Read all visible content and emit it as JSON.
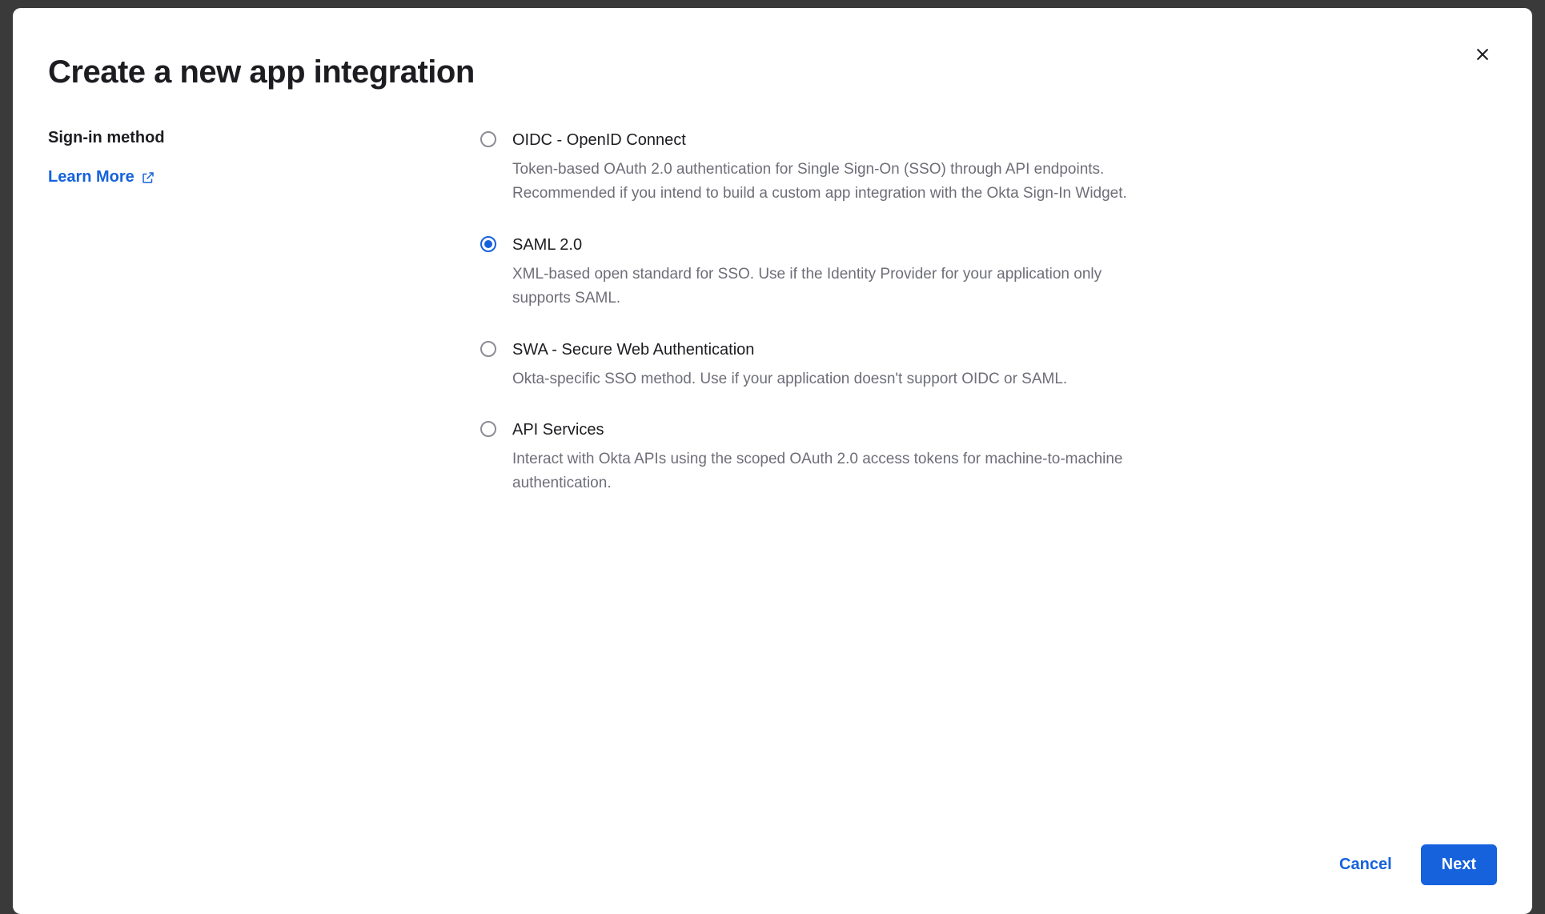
{
  "modal": {
    "title": "Create a new app integration",
    "close_aria": "Close"
  },
  "section": {
    "label": "Sign-in method",
    "learn_more": "Learn More"
  },
  "options": [
    {
      "id": "oidc",
      "title": "OIDC - OpenID Connect",
      "description": "Token-based OAuth 2.0 authentication for Single Sign-On (SSO) through API endpoints. Recommended if you intend to build a custom app integration with the Okta Sign-In Widget.",
      "selected": false
    },
    {
      "id": "saml",
      "title": "SAML 2.0",
      "description": "XML-based open standard for SSO. Use if the Identity Provider for your application only supports SAML.",
      "selected": true
    },
    {
      "id": "swa",
      "title": "SWA - Secure Web Authentication",
      "description": "Okta-specific SSO method. Use if your application doesn't support OIDC or SAML.",
      "selected": false
    },
    {
      "id": "api",
      "title": "API Services",
      "description": "Interact with Okta APIs using the scoped OAuth 2.0 access tokens for machine-to-machine authentication.",
      "selected": false
    }
  ],
  "footer": {
    "cancel": "Cancel",
    "next": "Next"
  }
}
